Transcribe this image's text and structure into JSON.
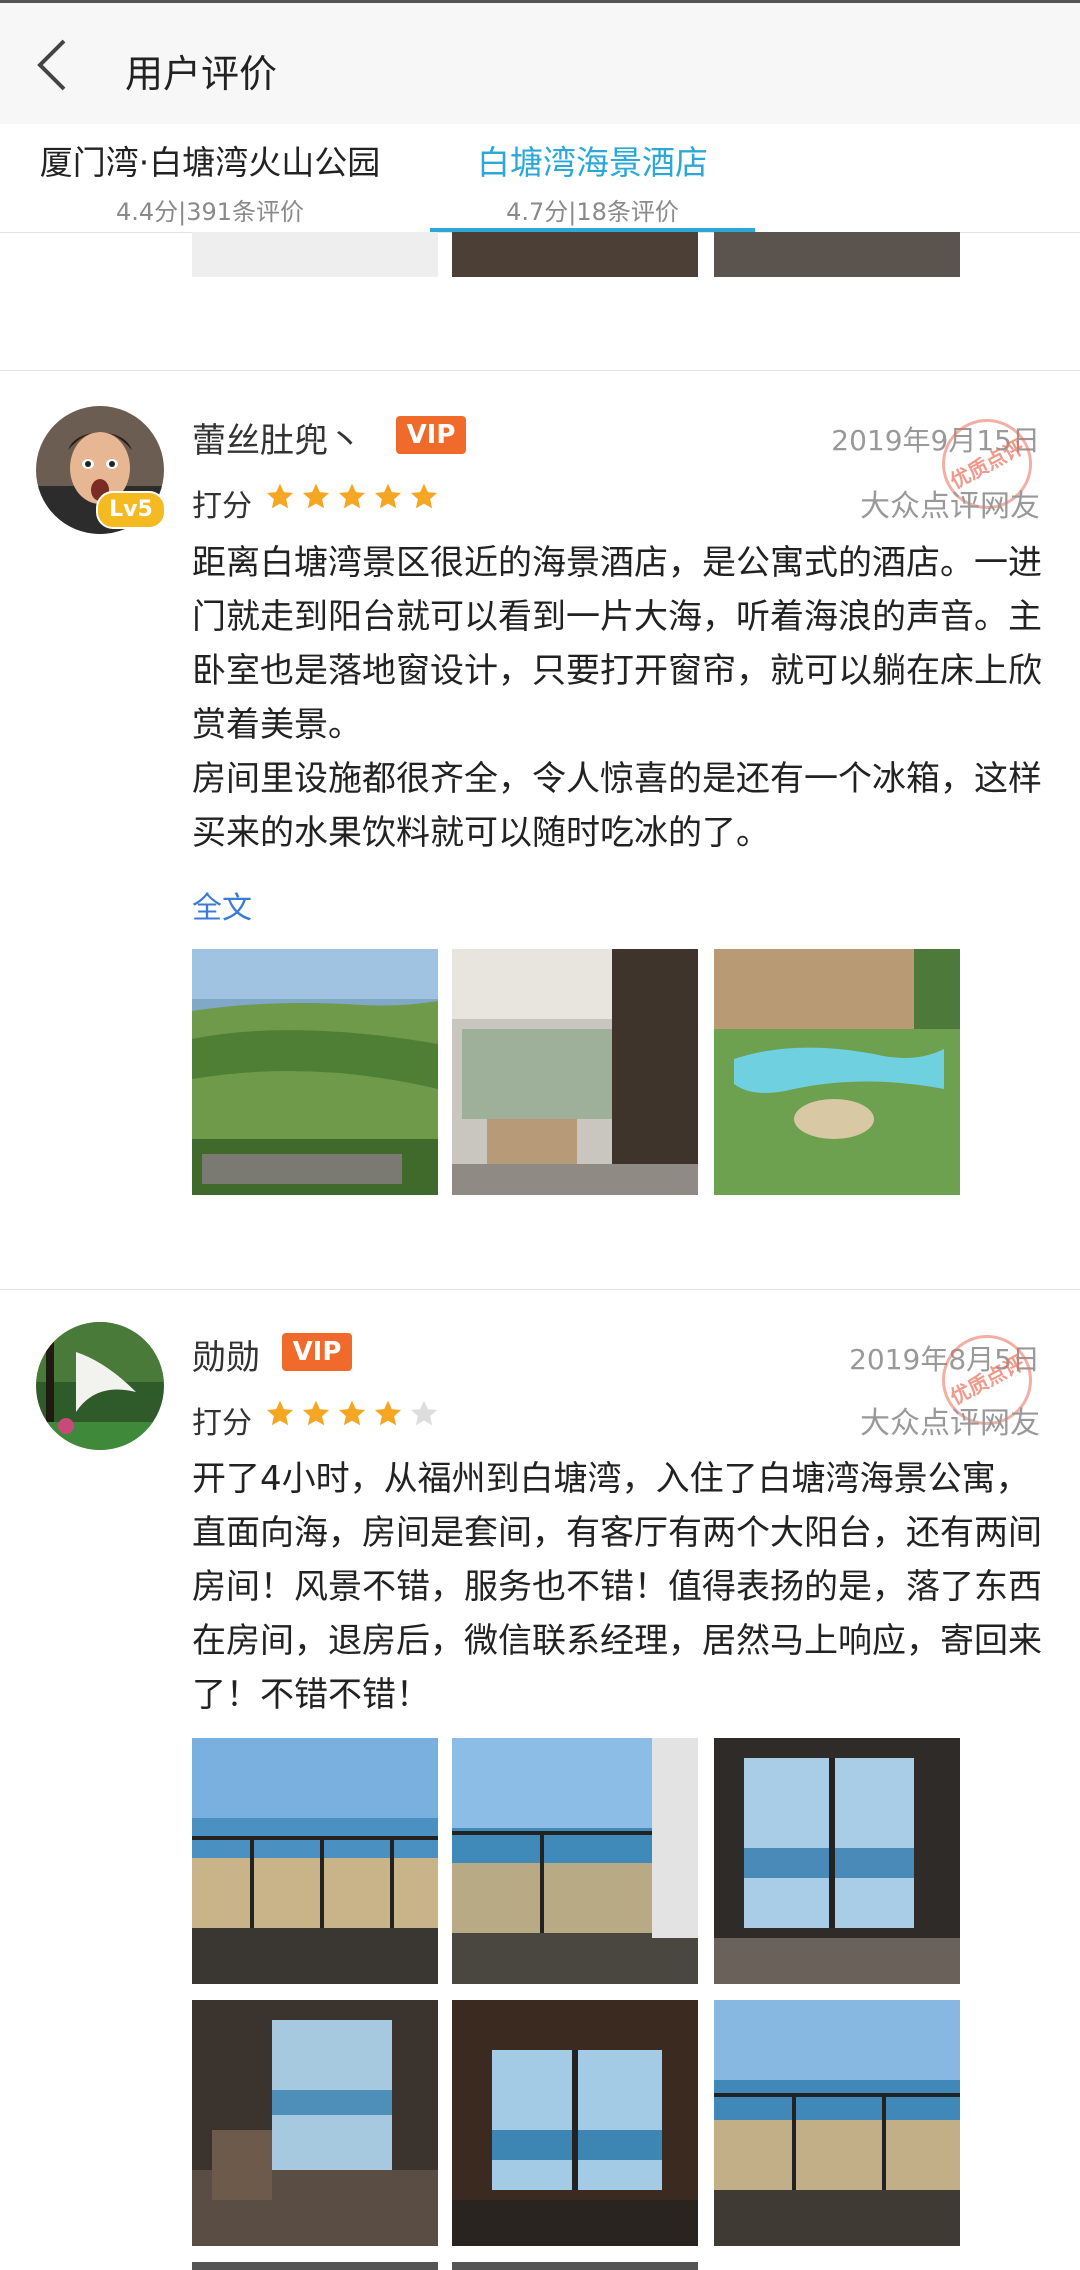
{
  "header": {
    "title": "用户评价"
  },
  "tabs": [
    {
      "name": "厦门湾·白塘湾火山公园",
      "score": "4.4分",
      "count": "391条评价",
      "active": false
    },
    {
      "name": "白塘湾海景酒店",
      "score": "4.7分",
      "count": "18条评价",
      "active": true
    }
  ],
  "reviews": [
    {
      "username": "蕾丝肚兜丶",
      "vip": "VIP",
      "level": "Lv5",
      "date": "2019年9月15日",
      "rating_label": "打分",
      "rating": 5,
      "source": "大众点评网友",
      "stamp": "优质点评",
      "paragraphs": [
        "距离白塘湾景区很近的海景酒店，是公寓式的酒店。一进门就走到阳台就可以看到一片大海，听着海浪的声音。主卧室也是落地窗设计，只要打开窗帘，就可以躺在床上欣赏着美景。",
        "房间里设施都很齐全，令人惊喜的是还有一个冰箱，这样买来的水果饮料就可以随时吃冰的了。"
      ],
      "more": "全文"
    },
    {
      "username": "勋勋",
      "vip": "VIP",
      "date": "2019年8月5日",
      "rating_label": "打分",
      "rating": 4,
      "source": "大众点评网友",
      "stamp": "优质点评",
      "paragraphs": [
        "开了4小时，从福州到白塘湾，入住了白塘湾海景公寓，直面向海，房间是套间，有客厅有两个大阳台，还有两间房间！风景不错，服务也不错！值得表扬的是，落了东西在房间，退房后，微信联系经理，居然马上响应，寄回来了！不错不错！"
      ]
    }
  ],
  "colors": {
    "accent": "#2ba8d8",
    "vip": "#f06a2c",
    "star": "#f5a623",
    "link": "#3a7bd5"
  }
}
